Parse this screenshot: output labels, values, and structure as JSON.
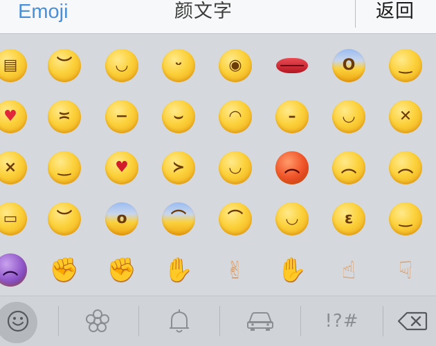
{
  "header": {
    "tab_emoji": "Emoji",
    "tab_kaomoji": "颜文字",
    "back_label": "返回"
  },
  "colors": {
    "accent": "#4a90d9",
    "panel_bg": "#d5d8dd",
    "toolbar_bg": "#d0d3d8",
    "header_bg": "#f7f8f9"
  },
  "emoji_grid": {
    "rows": [
      [
        "grimacing",
        "pensive",
        "blush",
        "stuck-out-tongue-winking-eye",
        "flushed",
        "lips",
        "scream",
        "relieved"
      ],
      [
        "heart-eyes",
        "confounded",
        "sweat",
        "smirk",
        "sob",
        "unamused",
        "grin",
        "tired-face"
      ],
      [
        "dizzy-face",
        "wink",
        "kissing-heart",
        "stuck-out-tongue-closed-eyes",
        "joy",
        "rage",
        "angry",
        "disappointed-relieved"
      ],
      [
        "mask",
        "sleepy",
        "fearful",
        "cold-sweat",
        "disappointed",
        "smiley",
        "kissing-closed-eyes",
        "relaxed"
      ],
      [
        "imp",
        "muscle",
        "punch",
        "thumbsup",
        "v",
        "thumbsdown",
        "point-up",
        "point-down"
      ]
    ]
  },
  "toolbar": {
    "items": [
      "smiley-icon",
      "flower-icon",
      "bell-icon",
      "car-icon",
      "symbols-key",
      "backspace-icon"
    ],
    "selected": "smiley-icon",
    "symbols_label": "!?#"
  }
}
